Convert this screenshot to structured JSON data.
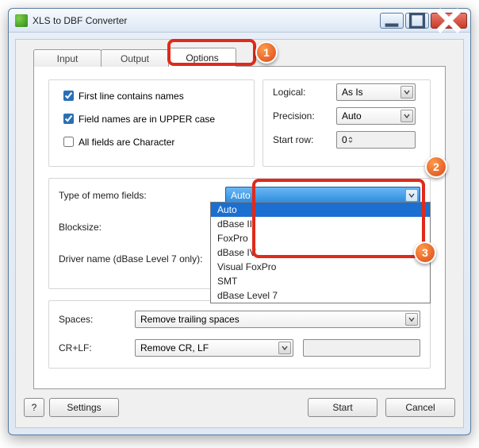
{
  "window": {
    "title": "XLS to DBF Converter"
  },
  "tabs": {
    "input": "Input",
    "output": "Output",
    "options": "Options"
  },
  "checks": {
    "firstline": "First line contains names",
    "upper": "Field names are in UPPER case",
    "allchar": "All fields are Character"
  },
  "right": {
    "logical_lbl": "Logical:",
    "logical_val": "As Is",
    "precision_lbl": "Precision:",
    "precision_val": "Auto",
    "startrow_lbl": "Start row:",
    "startrow_val": "0"
  },
  "memo": {
    "type_lbl": "Type of memo fields:",
    "type_val": "Auto",
    "block_lbl": "Blocksize:",
    "driver_lbl": "Driver name (dBase Level 7 only):",
    "options": [
      "Auto",
      "dBase III",
      "FoxPro",
      "dBase IV",
      "Visual FoxPro",
      "SMT",
      "dBase Level 7"
    ]
  },
  "bottom_group": {
    "spaces_lbl": "Spaces:",
    "spaces_val": "Remove trailing spaces",
    "crlf_lbl": "CR+LF:",
    "crlf_val": "Remove CR, LF"
  },
  "buttons": {
    "help": "?",
    "settings": "Settings",
    "start": "Start",
    "cancel": "Cancel"
  },
  "callouts": {
    "c1": "1",
    "c2": "2",
    "c3": "3"
  }
}
